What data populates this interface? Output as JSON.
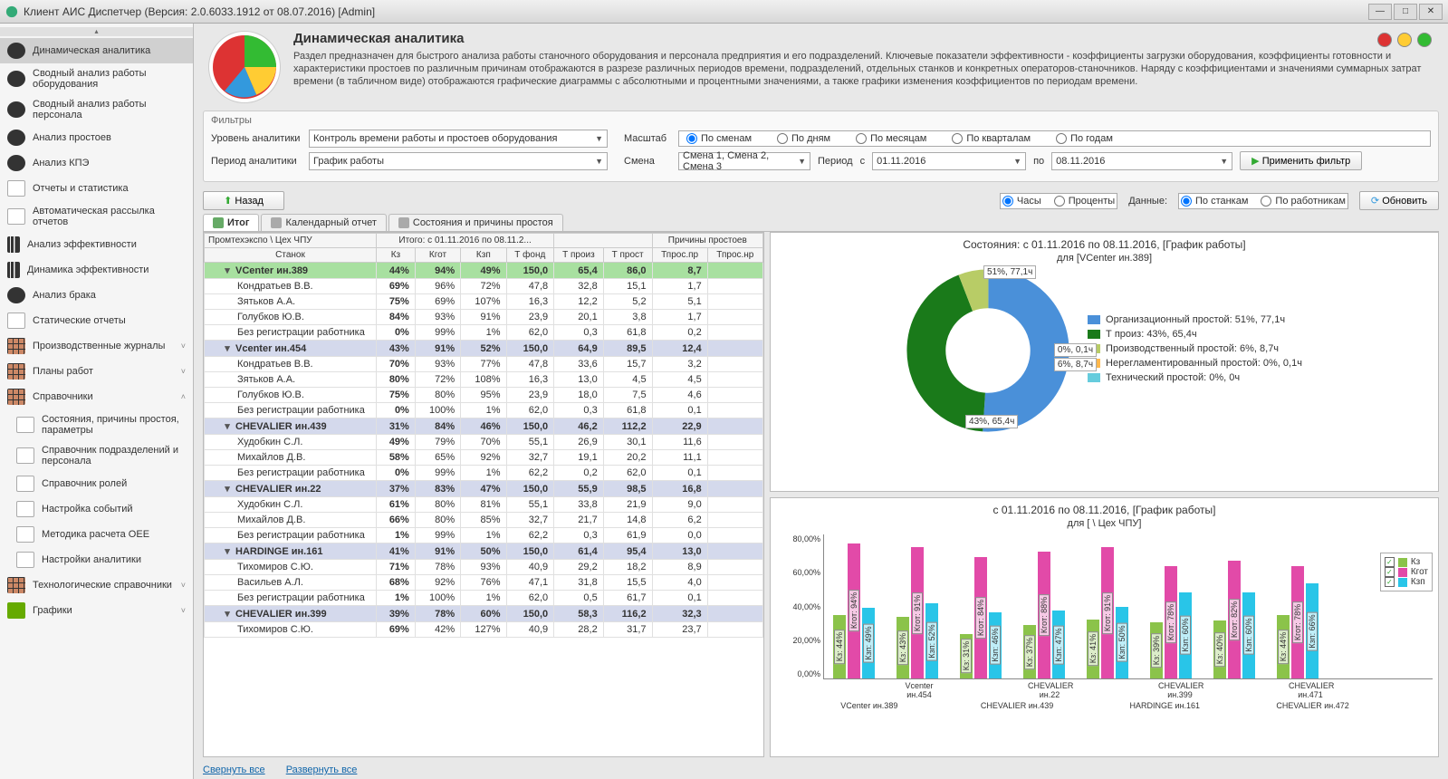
{
  "window": {
    "title": "Клиент АИС Диспетчер (Версия: 2.0.6033.1912 от 08.07.2016) [Admin]"
  },
  "sidebar": {
    "items": [
      {
        "label": "Динамическая аналитика",
        "icon": "pie",
        "selected": true
      },
      {
        "label": "Сводный анализ работы оборудования",
        "icon": "pie"
      },
      {
        "label": "Сводный анализ работы персонала",
        "icon": "pie"
      },
      {
        "label": "Анализ простоев",
        "icon": "pie"
      },
      {
        "label": "Анализ КПЭ",
        "icon": "pie"
      },
      {
        "label": "Отчеты и статистика",
        "icon": "doc"
      },
      {
        "label": "Автоматическая рассылка отчетов",
        "icon": "doc"
      },
      {
        "label": "Анализ эффективности",
        "icon": "bar"
      },
      {
        "label": "Динамика эффективности",
        "icon": "bar"
      },
      {
        "label": "Анализ брака",
        "icon": "pie"
      },
      {
        "label": "Статические отчеты",
        "icon": "doc"
      },
      {
        "label": "Производственные журналы",
        "icon": "grid",
        "chev": "˅"
      },
      {
        "label": "Планы работ",
        "icon": "grid",
        "chev": "˅"
      },
      {
        "label": "Справочники",
        "icon": "grid",
        "chev": "˄"
      },
      {
        "label": "Состояния, причины простоя, параметры",
        "icon": "doc",
        "sub": true
      },
      {
        "label": "Справочник подразделений и персонала",
        "icon": "doc",
        "sub": true
      },
      {
        "label": "Справочник ролей",
        "icon": "doc",
        "sub": true
      },
      {
        "label": "Настройка событий",
        "icon": "doc",
        "sub": true
      },
      {
        "label": "Методика расчета OEE",
        "icon": "doc",
        "sub": true
      },
      {
        "label": "Настройки аналитики",
        "icon": "doc",
        "sub": true
      },
      {
        "label": "Технологические справочники",
        "icon": "grid",
        "chev": "˅"
      },
      {
        "label": "Графики",
        "icon": "time",
        "chev": "˅"
      }
    ]
  },
  "header": {
    "title": "Динамическая аналитика",
    "desc": "Раздел предназначен для быстрого анализа работы станочного оборудования и персонала предприятия и его подразделений. Ключевые показатели эффективности - коэффициенты загрузки оборудования, коэффициенты готовности и характеристики простоев по различным причинам отображаются в разрезе различных периодов времени, подразделений, отдельных станков и конкретных операторов-станочников. Наряду с коэффициентами и значениями суммарных затрат времени (в табличном виде) отображаются графические диаграммы с абсолютными и процентными значениями, а также графики изменения коэффициентов по периодам времени."
  },
  "filters": {
    "section": "Фильтры",
    "level_label": "Уровень аналитики",
    "level_value": "Контроль времени работы и простоев оборудования",
    "period_label": "Период аналитики",
    "period_value": "График работы",
    "scale_label": "Масштаб",
    "scale_opts": [
      "По сменам",
      "По дням",
      "По месяцам",
      "По кварталам",
      "По годам"
    ],
    "shift_label": "Смена",
    "shift_value": "Смена 1, Смена 2, Смена 3",
    "range_label": "Период",
    "from_label": "с",
    "from_value": "01.11.2016",
    "to_label": "по",
    "to_value": "08.11.2016",
    "apply": "Применить фильтр",
    "back": "Назад",
    "units": [
      "Часы",
      "Проценты"
    ],
    "data_label": "Данные:",
    "data_opts": [
      "По станкам",
      "По работникам"
    ],
    "refresh": "Обновить"
  },
  "tabs": [
    "Итог",
    "Календарный отчет",
    "Состояния и причины простоя"
  ],
  "table": {
    "breadcrumb": "Промтехэкспо \\ Цех ЧПУ",
    "group_total": "Итого: с 01.11.2016 по 08.11.2...",
    "group_reasons": "Причины простоев",
    "name_col": "Станок",
    "cols": [
      "Кз",
      "Кгот",
      "Кзп",
      "Т фонд",
      "Т произ",
      "Т прост",
      "Тпрос.пр",
      "Тпрос.нр"
    ],
    "rows": [
      {
        "t": "g",
        "hl": true,
        "name": "VCenter ин.389",
        "v": [
          "44%",
          "94%",
          "49%",
          "150,0",
          "65,4",
          "86,0",
          "8,7",
          ""
        ]
      },
      {
        "t": "r",
        "name": "Кондратьев В.В.",
        "v": [
          "69%",
          "96%",
          "72%",
          "47,8",
          "32,8",
          "15,1",
          "1,7",
          ""
        ]
      },
      {
        "t": "r",
        "name": "Зятьков А.А.",
        "v": [
          "75%",
          "69%",
          "107%",
          "16,3",
          "12,2",
          "5,2",
          "5,1",
          ""
        ]
      },
      {
        "t": "r",
        "name": "Голубков Ю.В.",
        "v": [
          "84%",
          "93%",
          "91%",
          "23,9",
          "20,1",
          "3,8",
          "1,7",
          ""
        ]
      },
      {
        "t": "r",
        "name": "Без регистрации работника",
        "v": [
          "0%",
          "99%",
          "1%",
          "62,0",
          "0,3",
          "61,8",
          "0,2",
          ""
        ]
      },
      {
        "t": "g",
        "name": "Vcenter ин.454",
        "v": [
          "43%",
          "91%",
          "52%",
          "150,0",
          "64,9",
          "89,5",
          "12,4",
          ""
        ]
      },
      {
        "t": "r",
        "name": "Кондратьев В.В.",
        "v": [
          "70%",
          "93%",
          "77%",
          "47,8",
          "33,6",
          "15,7",
          "3,2",
          ""
        ]
      },
      {
        "t": "r",
        "name": "Зятьков А.А.",
        "v": [
          "80%",
          "72%",
          "108%",
          "16,3",
          "13,0",
          "4,5",
          "4,5",
          ""
        ]
      },
      {
        "t": "r",
        "name": "Голубков Ю.В.",
        "v": [
          "75%",
          "80%",
          "95%",
          "23,9",
          "18,0",
          "7,5",
          "4,6",
          ""
        ]
      },
      {
        "t": "r",
        "name": "Без регистрации работника",
        "v": [
          "0%",
          "100%",
          "1%",
          "62,0",
          "0,3",
          "61,8",
          "0,1",
          ""
        ]
      },
      {
        "t": "g",
        "name": "CHEVALIER ин.439",
        "v": [
          "31%",
          "84%",
          "46%",
          "150,0",
          "46,2",
          "112,2",
          "22,9",
          ""
        ]
      },
      {
        "t": "r",
        "name": "Худобкин С.Л.",
        "v": [
          "49%",
          "79%",
          "70%",
          "55,1",
          "26,9",
          "30,1",
          "11,6",
          ""
        ]
      },
      {
        "t": "r",
        "name": "Михайлов Д.В.",
        "v": [
          "58%",
          "65%",
          "92%",
          "32,7",
          "19,1",
          "20,2",
          "11,1",
          ""
        ]
      },
      {
        "t": "r",
        "name": "Без регистрации работника",
        "v": [
          "0%",
          "99%",
          "1%",
          "62,2",
          "0,2",
          "62,0",
          "0,1",
          ""
        ]
      },
      {
        "t": "g",
        "name": "CHEVALIER ин.22",
        "v": [
          "37%",
          "83%",
          "47%",
          "150,0",
          "55,9",
          "98,5",
          "16,8",
          ""
        ]
      },
      {
        "t": "r",
        "name": "Худобкин С.Л.",
        "v": [
          "61%",
          "80%",
          "81%",
          "55,1",
          "33,8",
          "21,9",
          "9,0",
          ""
        ]
      },
      {
        "t": "r",
        "name": "Михайлов Д.В.",
        "v": [
          "66%",
          "80%",
          "85%",
          "32,7",
          "21,7",
          "14,8",
          "6,2",
          ""
        ]
      },
      {
        "t": "r",
        "name": "Без регистрации работника",
        "v": [
          "1%",
          "99%",
          "1%",
          "62,2",
          "0,3",
          "61,9",
          "0,0",
          ""
        ]
      },
      {
        "t": "g",
        "name": "HARDINGE ин.161",
        "v": [
          "41%",
          "91%",
          "50%",
          "150,0",
          "61,4",
          "95,4",
          "13,0",
          ""
        ]
      },
      {
        "t": "r",
        "name": "Тихомиров С.Ю.",
        "v": [
          "71%",
          "78%",
          "93%",
          "40,9",
          "29,2",
          "18,2",
          "8,9",
          ""
        ]
      },
      {
        "t": "r",
        "name": "Васильев А.Л.",
        "v": [
          "68%",
          "92%",
          "76%",
          "47,1",
          "31,8",
          "15,5",
          "4,0",
          ""
        ]
      },
      {
        "t": "r",
        "name": "Без регистрации работника",
        "v": [
          "1%",
          "100%",
          "1%",
          "62,0",
          "0,5",
          "61,7",
          "0,1",
          ""
        ]
      },
      {
        "t": "g",
        "name": "CHEVALIER ин.399",
        "v": [
          "39%",
          "78%",
          "60%",
          "150,0",
          "58,3",
          "116,2",
          "32,3",
          ""
        ]
      },
      {
        "t": "r",
        "name": "Тихомиров С.Ю.",
        "v": [
          "69%",
          "42%",
          "127%",
          "40,9",
          "28,2",
          "31,7",
          "23,7",
          ""
        ]
      }
    ],
    "footer": {
      "collapse": "Свернуть все",
      "expand": "Развернуть все"
    }
  },
  "chart_data": [
    {
      "type": "pie",
      "title": "Состояния: с 01.11.2016 по 08.11.2016, [График работы]",
      "subtitle": "для [VCenter ин.389]",
      "series": [
        {
          "name": "Организационный простой",
          "pct": 51,
          "hours": "77,1ч",
          "color": "#4a90d9"
        },
        {
          "name": "Т произ",
          "pct": 43,
          "hours": "65,4ч",
          "color": "#1a7a1a"
        },
        {
          "name": "Производственный простой",
          "pct": 6,
          "hours": "8,7ч",
          "color": "#b8cc66"
        },
        {
          "name": "Нерегламентированный простой",
          "pct": 0,
          "hours": "0,1ч",
          "color": "#ffb84d"
        },
        {
          "name": "Технический простой",
          "pct": 0,
          "hours": "0ч",
          "color": "#66ccdd"
        }
      ],
      "callouts": [
        "51%, 77,1ч",
        "43%, 65,4ч",
        "6%, 8,7ч",
        "0%, 0,1ч"
      ]
    },
    {
      "type": "bar",
      "title": "с 01.11.2016 по 08.11.2016, [График работы]",
      "subtitle": "для [                 \\ Цех ЧПУ]",
      "ylabel": "%",
      "ylim": [
        0,
        100
      ],
      "yticks": [
        "0,00%",
        "20,00%",
        "40,00%",
        "60,00%",
        "80,00%"
      ],
      "legend": [
        "Кз",
        "Кгот",
        "Кзп"
      ],
      "colors": {
        "Кз": "#8BC34A",
        "Кгот": "#E24AA8",
        "Кзп": "#29C5E8"
      },
      "categories": [
        "VCenter ин.389",
        "Vcenter ин.454",
        "CHEVALIER ин.439",
        "CHEVALIER ин.22",
        "HARDINGE ин.161",
        "CHEVALIER ин.399",
        "CHEVALIER ин.471",
        "CHEVALIER ин.472"
      ],
      "categories_row1": [
        "",
        "Vcenter ин.454",
        "",
        "CHEVALIER ин.22",
        "",
        "CHEVALIER ин.399",
        "",
        "CHEVALIER ин.471"
      ],
      "categories_row2": [
        "VCenter ин.389",
        "",
        "CHEVALIER ин.439",
        "",
        "HARDINGE ин.161",
        "",
        "CHEVALIER ин.472",
        ""
      ],
      "series": [
        {
          "name": "Кз",
          "values": [
            44,
            43,
            31,
            37,
            41,
            39,
            40,
            44
          ]
        },
        {
          "name": "Кгот",
          "values": [
            94,
            91,
            84,
            88,
            91,
            78,
            82,
            78
          ]
        },
        {
          "name": "Кзп",
          "values": [
            49,
            52,
            46,
            47,
            50,
            60,
            60,
            66
          ]
        }
      ]
    }
  ]
}
